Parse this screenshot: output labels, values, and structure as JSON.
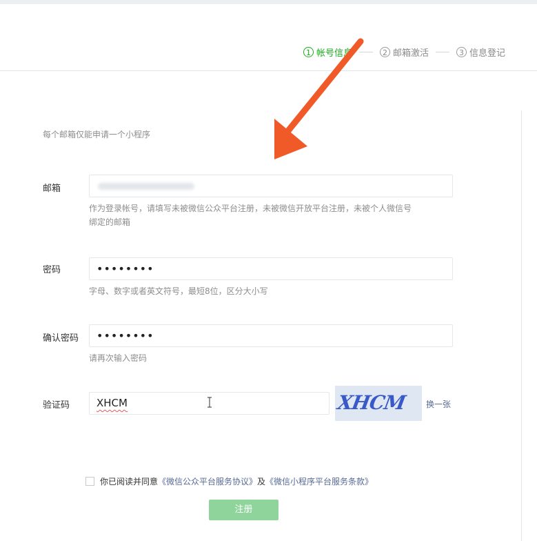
{
  "steps": [
    {
      "num": "1",
      "label": "帐号信息",
      "active": true
    },
    {
      "num": "2",
      "label": "邮箱激活",
      "active": false
    },
    {
      "num": "3",
      "label": "信息登记",
      "active": false
    }
  ],
  "form": {
    "note": "每个邮箱仅能申请一个小程序",
    "email": {
      "label": "邮箱",
      "help_line1": "作为登录帐号，请填写未被微信公众平台注册，未被微信开放平台注册，未被个人微信号",
      "help_line2": "绑定的邮箱"
    },
    "password": {
      "label": "密码",
      "value": "••••••••",
      "help": "字母、数字或者英文符号，最短8位，区分大小写"
    },
    "confirm": {
      "label": "确认密码",
      "value": "••••••••",
      "help": "请再次输入密码"
    },
    "captcha": {
      "label": "验证码",
      "value": "XHCM",
      "image_text": "XHCM",
      "refresh": "换一张"
    },
    "agreement": {
      "prefix": "你已阅读并同意",
      "link1": "《微信公众平台服务协议》",
      "and": "及",
      "link2": "《微信小程序平台服务条款》"
    },
    "submit": "注册"
  },
  "colors": {
    "active_step": "#1aad19",
    "link": "#576b95",
    "submit_bg": "#8fd49a",
    "arrow": "#ef5a28"
  },
  "icons": {
    "annotation": "arrow-icon",
    "cursor": "text-cursor-icon"
  }
}
